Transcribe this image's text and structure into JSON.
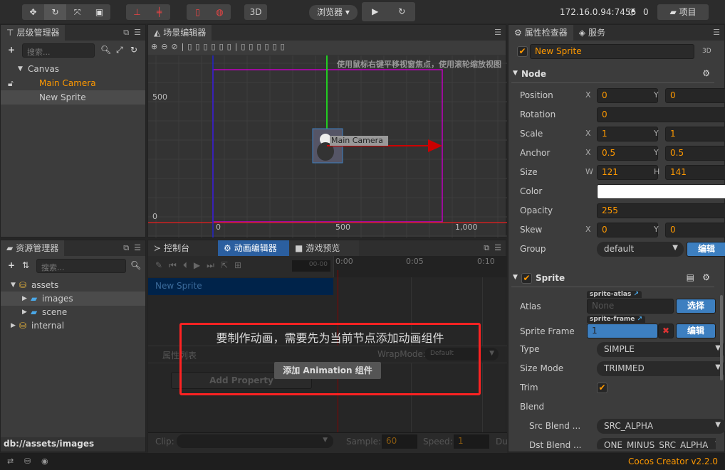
{
  "toolbar": {
    "tools": [
      "move-icon",
      "rotate-icon",
      "scale-icon",
      "rect-icon"
    ],
    "pivot": [
      "pivot-icon",
      "center-icon"
    ],
    "coord": [
      "local-icon",
      "global-icon"
    ],
    "mode_3d": "3D",
    "preview_target": "浏览器",
    "play": "play-icon",
    "refresh": "refresh-icon",
    "ip": "172.16.0.94:7456",
    "connections": "0",
    "project_button": "项目"
  },
  "hierarchy": {
    "title": "层级管理器",
    "search_placeholder": "搜索...",
    "items": [
      {
        "label": "Canvas",
        "color": "#cccccc"
      },
      {
        "label": "Main Camera",
        "color": "#ff9900"
      },
      {
        "label": "New Sprite",
        "color": "#cccccc"
      }
    ]
  },
  "assets": {
    "title": "资源管理器",
    "search_placeholder": "搜索...",
    "items": [
      {
        "label": "assets"
      },
      {
        "label": "images"
      },
      {
        "label": "scene"
      },
      {
        "label": "internal"
      }
    ],
    "path": "db://assets/images"
  },
  "scene": {
    "title": "场景编辑器",
    "hint": "使用鼠标右键平移视窗焦点，使用滚轮缩放视图",
    "y_labels": [
      "500",
      "0"
    ],
    "x_labels": [
      "0",
      "500",
      "1,000"
    ],
    "camera_label": "Main Camera"
  },
  "bottom_tabs": [
    {
      "label": "控制台"
    },
    {
      "label": "动画编辑器"
    },
    {
      "label": "游戏预览"
    }
  ],
  "anim": {
    "time_field": "00-00",
    "ticks": [
      "0:00",
      "0:05",
      "0:10"
    ],
    "node": "New Sprite",
    "prop_list": "属性列表",
    "wrapmode_label": "WrapMode:",
    "wrapmode": "Default",
    "add_property": "Add Property",
    "notice": "要制作动画，需要先为当前节点添加动画组件",
    "add_component": "添加 Animation 组件",
    "clip_label": "Clip:",
    "sample_label": "Sample:",
    "sample": "60",
    "speed_label": "Speed:",
    "speed": "1",
    "duration_label": "Du"
  },
  "inspector": {
    "title": "属性检查器",
    "service": "服务",
    "node_name": "New Sprite",
    "mode_3d": "3D",
    "node": {
      "title": "Node",
      "position": {
        "label": "Position",
        "x": "0",
        "y": "0"
      },
      "rotation": {
        "label": "Rotation",
        "value": "0"
      },
      "scale": {
        "label": "Scale",
        "x": "1",
        "y": "1"
      },
      "anchor": {
        "label": "Anchor",
        "x": "0.5",
        "y": "0.5"
      },
      "size": {
        "label": "Size",
        "w": "121",
        "h": "141"
      },
      "color": {
        "label": "Color",
        "value": "#ffffff"
      },
      "opacity": {
        "label": "Opacity",
        "value": "255"
      },
      "skew": {
        "label": "Skew",
        "x": "0",
        "y": "0"
      },
      "group": {
        "label": "Group",
        "value": "default",
        "edit": "编辑"
      }
    },
    "sprite": {
      "title": "Sprite",
      "atlas": {
        "label": "Atlas",
        "tag": "sprite-atlas",
        "value": "None",
        "button": "选择"
      },
      "frame": {
        "label": "Sprite Frame",
        "tag": "sprite-frame",
        "value": "1",
        "button": "编辑"
      },
      "type": {
        "label": "Type",
        "value": "SIMPLE"
      },
      "size_mode": {
        "label": "Size Mode",
        "value": "TRIMMED"
      },
      "trim": {
        "label": "Trim",
        "checked": true
      },
      "blend": {
        "label": "Blend"
      },
      "src": {
        "label": "Src Blend ...",
        "value": "SRC_ALPHA"
      },
      "dst": {
        "label": "Dst Blend ...",
        "value": "ONE_MINUS_SRC_ALPHA"
      }
    },
    "axis_x": "X",
    "axis_y": "Y",
    "axis_w": "W",
    "axis_h": "H"
  },
  "status": {
    "version": "Cocos Creator v2.2.0"
  },
  "colors": {
    "accent": "#ff9900",
    "selection": "#3d7fc0",
    "canvas": "#c000c0"
  }
}
